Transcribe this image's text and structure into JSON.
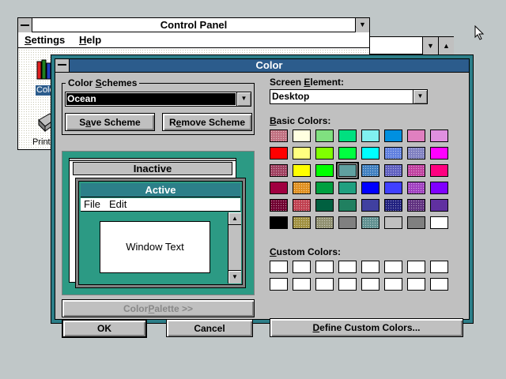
{
  "control_panel": {
    "title": "Control Panel",
    "menu": [
      {
        "label_u": "S",
        "label_rest": "ettings"
      },
      {
        "label_u": "H",
        "label_rest": "elp"
      }
    ],
    "icons": [
      {
        "label": "Colo",
        "name": "color-icon"
      },
      {
        "label": "Printe",
        "name": "printers-icon"
      }
    ]
  },
  "dialog": {
    "title": "Color",
    "color_schemes": {
      "label_pre": "Color ",
      "label_u": "S",
      "label_post": "chemes",
      "value": "Ocean",
      "save_label_u": "a",
      "save_label_pre": "S",
      "save_label_post": "ve Scheme",
      "remove_label_pre": "R",
      "remove_label_u": "e",
      "remove_label_post": "move Scheme"
    },
    "preview": {
      "inactive_title": "Inactive",
      "active_title": "Active",
      "menu_file": "File",
      "menu_edit": "Edit",
      "window_text": "Window Text"
    },
    "color_palette_button": {
      "pre": "Color ",
      "u": "P",
      "post": "alette >>"
    },
    "ok_label": "OK",
    "cancel_label": "Cancel",
    "screen_element": {
      "label_pre": "Screen ",
      "label_u": "E",
      "label_post": "lement:",
      "value": "Desktop"
    },
    "basic_colors_label": {
      "u": "B",
      "rest": "asic Colors:"
    },
    "custom_colors_label": {
      "u": "C",
      "rest": "ustom Colors:"
    },
    "define_button": {
      "u": "D",
      "rest": "efine Custom Colors..."
    },
    "basic_colors": [
      [
        "#c07080",
        "#ffffe0",
        "#80e080",
        "#00e080",
        "#80f0f0",
        "#0090e0",
        "#e080c0",
        "#e090e0"
      ],
      [
        "#ff0000",
        "#ffff80",
        "#80ff00",
        "#00ff40",
        "#00ffff",
        "#6080e0",
        "#8080c0",
        "#ff00ff"
      ],
      [
        "#a04060",
        "#ffff00",
        "#00ff00",
        "#60a0a0",
        "#4080c0",
        "#6060c0",
        "#c040a0",
        "#ff0080"
      ],
      [
        "#a00040",
        "#e09020",
        "#00a040",
        "#20a080",
        "#0000ff",
        "#4040ff",
        "#a040c0",
        "#8000ff"
      ],
      [
        "#700030",
        "#c04050",
        "#006040",
        "#208060",
        "#4040a0",
        "#202080",
        "#603080",
        "#6030a0"
      ],
      [
        "#000000",
        "#a09040",
        "#909070",
        "#808080",
        "#609090",
        "#c0c0c0",
        "#808080",
        "#ffffff"
      ]
    ],
    "selected_basic": [
      2,
      3
    ]
  }
}
